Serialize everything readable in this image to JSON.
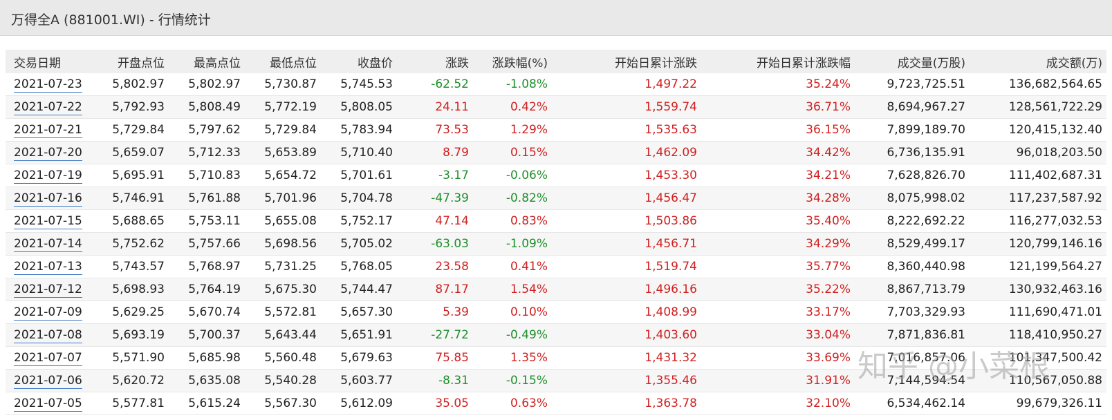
{
  "window": {
    "title": "万得全A (881001.WI) - 行情统计"
  },
  "colors": {
    "up": "#d12020",
    "down": "#1f8f2a"
  },
  "table": {
    "headers": [
      "交易日期",
      "开盘点位",
      "最高点位",
      "最低点位",
      "收盘价",
      "涨跌",
      "涨跌幅(%)",
      "开始日累计涨跌",
      "开始日累计涨跌幅",
      "成交量(万股)",
      "成交额(万)"
    ],
    "rows": [
      [
        "2021-07-23",
        "5,802.97",
        "5,802.97",
        "5,730.87",
        "5,745.53",
        "-62.52",
        "-1.08%",
        "1,497.22",
        "35.24%",
        "9,723,725.51",
        "136,682,564.65"
      ],
      [
        "2021-07-22",
        "5,792.93",
        "5,808.49",
        "5,772.19",
        "5,808.05",
        "24.11",
        "0.42%",
        "1,559.74",
        "36.71%",
        "8,694,967.27",
        "128,561,722.29"
      ],
      [
        "2021-07-21",
        "5,729.84",
        "5,797.62",
        "5,729.84",
        "5,783.94",
        "73.53",
        "1.29%",
        "1,535.63",
        "36.15%",
        "7,899,189.70",
        "120,415,132.40"
      ],
      [
        "2021-07-20",
        "5,659.07",
        "5,712.33",
        "5,653.89",
        "5,710.40",
        "8.79",
        "0.15%",
        "1,462.09",
        "34.42%",
        "6,736,135.91",
        "96,018,203.50"
      ],
      [
        "2021-07-19",
        "5,695.91",
        "5,710.83",
        "5,654.72",
        "5,701.61",
        "-3.17",
        "-0.06%",
        "1,453.30",
        "34.21%",
        "7,628,826.70",
        "111,402,687.31"
      ],
      [
        "2021-07-16",
        "5,746.91",
        "5,761.88",
        "5,701.96",
        "5,704.78",
        "-47.39",
        "-0.82%",
        "1,456.47",
        "34.28%",
        "8,075,998.02",
        "117,237,587.92"
      ],
      [
        "2021-07-15",
        "5,688.65",
        "5,753.11",
        "5,655.08",
        "5,752.17",
        "47.14",
        "0.83%",
        "1,503.86",
        "35.40%",
        "8,222,692.22",
        "116,277,032.53"
      ],
      [
        "2021-07-14",
        "5,752.62",
        "5,757.66",
        "5,698.56",
        "5,705.02",
        "-63.03",
        "-1.09%",
        "1,456.71",
        "34.29%",
        "8,529,499.17",
        "120,799,146.16"
      ],
      [
        "2021-07-13",
        "5,743.57",
        "5,768.97",
        "5,731.25",
        "5,768.05",
        "23.58",
        "0.41%",
        "1,519.74",
        "35.77%",
        "8,360,440.98",
        "121,199,564.27"
      ],
      [
        "2021-07-12",
        "5,698.93",
        "5,764.19",
        "5,675.30",
        "5,744.47",
        "87.17",
        "1.54%",
        "1,496.16",
        "35.22%",
        "8,867,713.79",
        "130,932,463.16"
      ],
      [
        "2021-07-09",
        "5,629.25",
        "5,670.74",
        "5,572.81",
        "5,657.30",
        "5.39",
        "0.10%",
        "1,408.99",
        "33.17%",
        "7,703,329.93",
        "111,690,471.01"
      ],
      [
        "2021-07-08",
        "5,693.19",
        "5,700.37",
        "5,643.44",
        "5,651.91",
        "-27.72",
        "-0.49%",
        "1,403.60",
        "33.04%",
        "7,871,836.81",
        "118,410,950.27"
      ],
      [
        "2021-07-07",
        "5,571.90",
        "5,685.98",
        "5,560.48",
        "5,679.63",
        "75.85",
        "1.35%",
        "1,431.32",
        "33.69%",
        "7,016,857.06",
        "101,347,500.42"
      ],
      [
        "2021-07-06",
        "5,620.72",
        "5,635.08",
        "5,540.28",
        "5,603.77",
        "-8.31",
        "-0.15%",
        "1,355.46",
        "31.91%",
        "7,144,594.54",
        "110,567,050.88"
      ],
      [
        "2021-07-05",
        "5,577.81",
        "5,615.24",
        "5,567.30",
        "5,612.09",
        "35.05",
        "0.63%",
        "1,363.78",
        "32.10%",
        "6,534,462.14",
        "99,679,326.11"
      ]
    ]
  },
  "watermark": "知乎 @小菜根"
}
